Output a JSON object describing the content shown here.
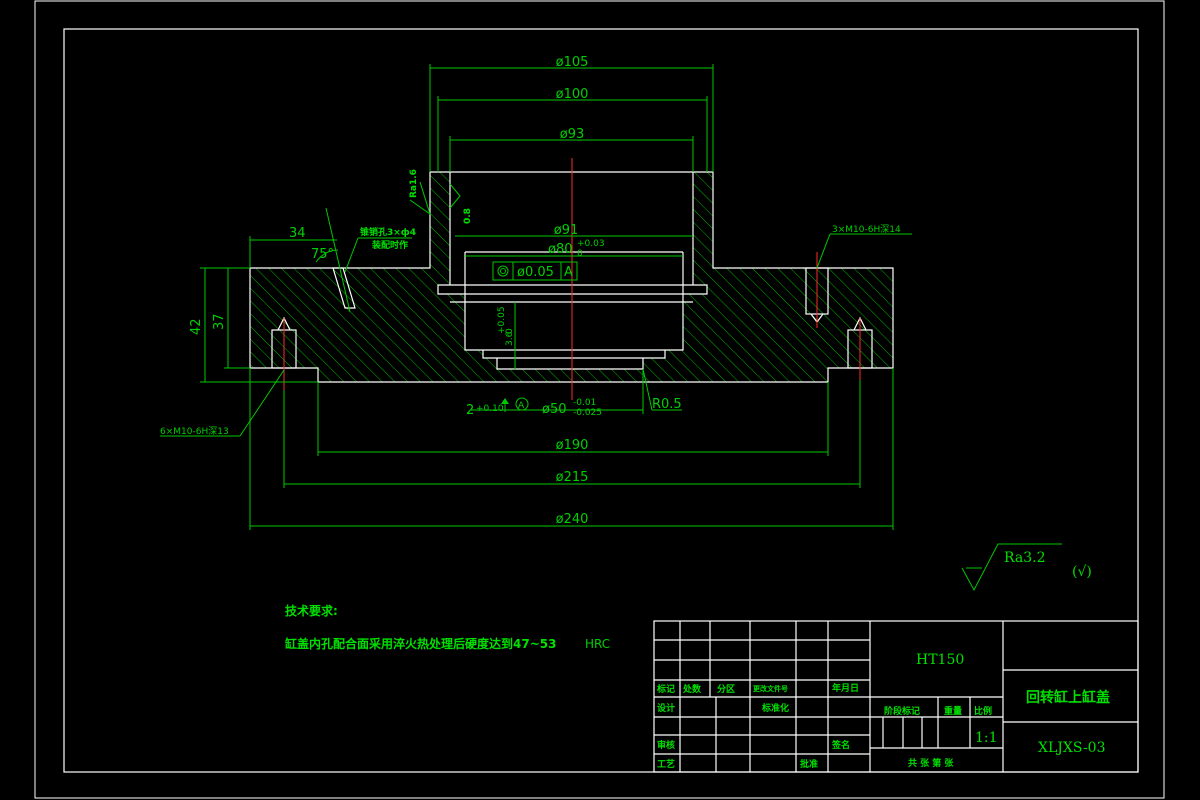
{
  "dimensions": {
    "d105": "ø105",
    "d100": "ø100",
    "d93": "ø93",
    "d91": "ø91",
    "d80": "ø80",
    "d80_tol_up": "+0.03",
    "d80_tol_low": "0",
    "d50": "ø50",
    "d50_tol_up": "-0.01",
    "d50_tol_low": "-0.025",
    "d190": "ø190",
    "d215": "ø215",
    "d240": "ø240",
    "len34": "34",
    "ang75": "75°",
    "h42": "42",
    "h37": "37",
    "h36": "3.6",
    "h36_tol": "+0.05",
    "h36_tol_low": "0",
    "w2": "2",
    "w2_tol": "+0.10",
    "r05": "R0.5",
    "datum": "A",
    "ra16": "Ra1.6",
    "ra08": "0.8"
  },
  "tolerance_frame": {
    "value": "ø0.05",
    "datum": "A"
  },
  "notes": {
    "hole_left": "锥销孔3×ф4",
    "hole_left2": "装配时作",
    "thread_top_right": "3×M10-6H深14",
    "thread_bottom_left": "6×M10-6H深13"
  },
  "roughness": {
    "value": "Ra3.2",
    "suffix": "(√)"
  },
  "tech": {
    "title": "技术要求:",
    "line1_cn": "缸盖内孔配合面采用淬火热处理后硬度达到47~53",
    "line1_unit": "HRC"
  },
  "title_block": {
    "material": "HT150",
    "part_name": "回转缸上缸盖",
    "drawing_no": "XLJXS-03",
    "scale": "1:1",
    "hdr_mark": "标记",
    "hdr_count": "处数",
    "hdr_zone": "分区",
    "hdr_doc": "更改文件号",
    "hdr_date": "年月日",
    "design": "设计",
    "standard": "标准化",
    "stage": "阶段标记",
    "weight": "重量",
    "scale_label": "比例",
    "check": "审核",
    "sign": "签名",
    "process": "工艺",
    "approve": "批准",
    "sheets": "共  张  第  张"
  }
}
